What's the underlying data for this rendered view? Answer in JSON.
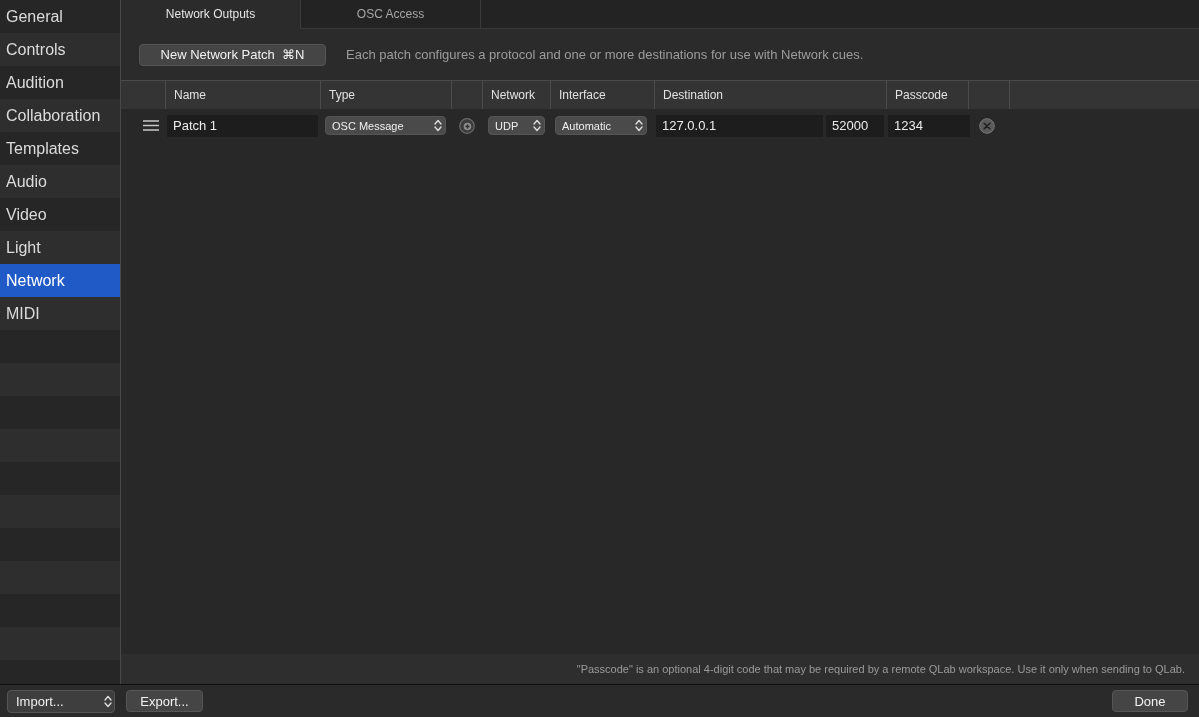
{
  "sidebar": {
    "items": [
      {
        "label": "General",
        "selected": false
      },
      {
        "label": "Controls",
        "selected": false
      },
      {
        "label": "Audition",
        "selected": false
      },
      {
        "label": "Collaboration",
        "selected": false
      },
      {
        "label": "Templates",
        "selected": false
      },
      {
        "label": "Audio",
        "selected": false
      },
      {
        "label": "Video",
        "selected": false
      },
      {
        "label": "Light",
        "selected": false
      },
      {
        "label": "Network",
        "selected": true
      },
      {
        "label": "MIDI",
        "selected": false
      }
    ]
  },
  "tabs": [
    {
      "label": "Network Outputs",
      "selected": true
    },
    {
      "label": "OSC Access",
      "selected": false
    }
  ],
  "toolbar": {
    "new_patch_button": {
      "label": "New Network Patch",
      "shortcut": "⌘N"
    },
    "description": "Each patch configures a protocol and one or more destinations for use with Network cues."
  },
  "table": {
    "columns": [
      "Name",
      "Type",
      "Network",
      "Interface",
      "Destination",
      "Passcode"
    ],
    "rows": [
      {
        "name": "Patch 1",
        "type": "OSC Message",
        "network": "UDP",
        "interface": "Automatic",
        "destination": "127.0.0.1",
        "port": "52000",
        "passcode": "1234"
      }
    ]
  },
  "note": "\"Passcode\" is an optional 4-digit code that may be required by a remote QLab workspace. Use it only when sending to QLab.",
  "footer": {
    "import_menu": "Import...",
    "export_button": "Export...",
    "done_button": "Done"
  }
}
